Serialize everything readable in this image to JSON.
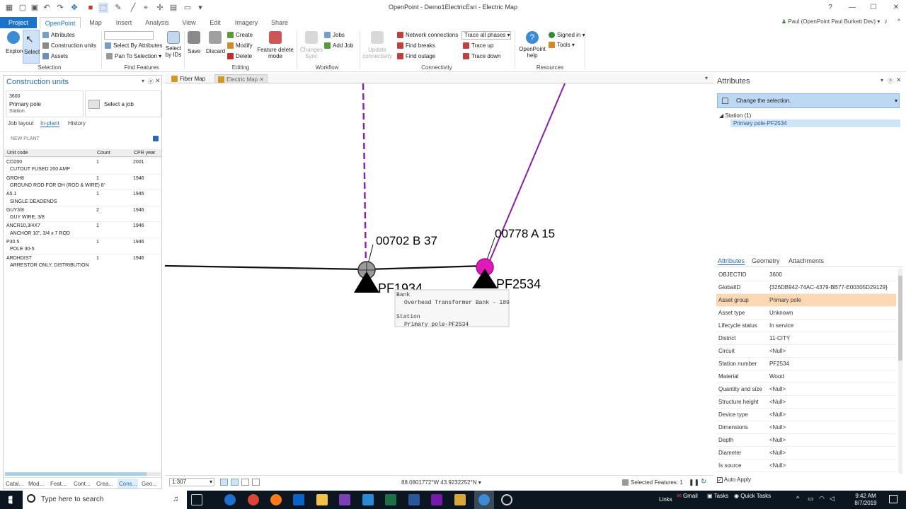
{
  "window": {
    "title": "OpenPoint - Demo1ElectricEsri - Electric Map",
    "help": "?",
    "minimize": "—",
    "maximize": "☐",
    "close": "✕"
  },
  "ribbon_tabs": [
    "Project",
    "OpenPoint",
    "Map",
    "Insert",
    "Analysis",
    "View",
    "Edit",
    "Imagery",
    "Share"
  ],
  "user": {
    "name": "Paul (OpenPoint Paul Burkett Dev)",
    "dropdown": "▾"
  },
  "ribbon": {
    "selection": {
      "explore": "Explore",
      "select": "Select",
      "attributes": "Attributes",
      "construction_units": "Construction units",
      "assets": "Assets",
      "group": "Selection"
    },
    "find": {
      "select_by_attributes": "Select By Attributes",
      "pan_to_selection": "Pan To Selection",
      "select_by_ids": "Select by IDs",
      "group": "Find Features"
    },
    "editing": {
      "save": "Save",
      "discard": "Discard",
      "create": "Create",
      "modify": "Modify",
      "delete": "Delete",
      "feature_delete": "Feature delete mode",
      "group": "Editing"
    },
    "workflow": {
      "changes_sync": "Changes Sync",
      "jobs": "Jobs",
      "add_job": "Add Job",
      "group": "Workflow"
    },
    "connectivity": {
      "update": "Update connectivity",
      "network": "Network connections",
      "trace_combo": "Trace all phases",
      "trace_up": "Trace up",
      "find_breaks": "Find breaks",
      "trace_down": "Trace down",
      "find_outage": "Find outage",
      "group": "Connectivity"
    },
    "resources": {
      "help": "OpenPoint help",
      "signed_in": "Signed in",
      "tools": "Tools",
      "group": "Resources"
    }
  },
  "left": {
    "title": "Construction units",
    "card": {
      "id": "3600",
      "name": "Primary pole",
      "type": "Station",
      "job": "Select a job"
    },
    "tabs": [
      "Job layout",
      "In-plant",
      "History"
    ],
    "new_plant": "NEW PLANT",
    "columns": [
      "Unit code",
      "Count",
      "CPR year"
    ],
    "rows": [
      {
        "code": "CO200",
        "count": "1",
        "year": "2001",
        "desc": "CUTOUT FUSED 200 AMP"
      },
      {
        "code": "GROH8",
        "count": "1",
        "year": "1946",
        "desc": "GROUND ROD FOR OH (ROD & WIRE) 8'"
      },
      {
        "code": "A5.1",
        "count": "1",
        "year": "1946",
        "desc": "SINGLE DEADENDS"
      },
      {
        "code": "GUY3/8",
        "count": "2",
        "year": "1946",
        "desc": "GUY WIRE, 3/8"
      },
      {
        "code": "ANCR10,3/4X7",
        "count": "1",
        "year": "1946",
        "desc": "ANCHOR 10\", 3/4 x 7 ROD"
      },
      {
        "code": "P30.5",
        "count": "1",
        "year": "1946",
        "desc": "POLE 30-5"
      },
      {
        "code": "ARDHDIST",
        "count": "1",
        "year": "1946",
        "desc": "ARRESTOR ONLY, DISTRIBUTION"
      }
    ],
    "bottom_tabs": [
      "Catal...",
      "Mod...",
      "Feat...",
      "Cont...",
      "Crea...",
      "Cons...",
      "Geo..."
    ]
  },
  "map": {
    "tabs": [
      "Fiber Map",
      "Electric Map"
    ],
    "labels": {
      "l1": "00702 B 37",
      "l2": "00778 A 15",
      "p1": "PF1934",
      "p2": "PF2534"
    },
    "popup": {
      "h1": "Bank",
      "v1": "Overhead Transformer Bank - 189",
      "h2": "Station",
      "v2": "Primary pole-PF2534"
    },
    "scale": "1:307",
    "coords": "88.0801772°W 43.9232252°N",
    "selected": "Selected Features: 1"
  },
  "right": {
    "title": "Attributes",
    "change_sel": "Change the selection.",
    "tree_root": "Station (1)",
    "tree_child": "Primary pole-PF2534",
    "tabs": [
      "Attributes",
      "Geometry",
      "Attachments"
    ],
    "rows": [
      {
        "k": "OBJECTID",
        "v": "3600"
      },
      {
        "k": "GlobalID",
        "v": "{326DB942-74AC-4379-BB77-E00305D29129}"
      },
      {
        "k": "Asset group",
        "v": "Primary pole"
      },
      {
        "k": "Asset type",
        "v": "Unknown"
      },
      {
        "k": "Lifecycle status",
        "v": "In service"
      },
      {
        "k": "District",
        "v": "11-CITY"
      },
      {
        "k": "Circuit",
        "v": "<Null>"
      },
      {
        "k": "Station number",
        "v": "PF2534"
      },
      {
        "k": "Material",
        "v": "Wood"
      },
      {
        "k": "Quantity and size",
        "v": "<Null>"
      },
      {
        "k": "Structure height",
        "v": "<Null>"
      },
      {
        "k": "Device type",
        "v": "<Null>"
      },
      {
        "k": "Dimensions",
        "v": "<Null>"
      },
      {
        "k": "Depth",
        "v": "<Null>"
      },
      {
        "k": "Diameter",
        "v": "<Null>"
      },
      {
        "k": "Is source",
        "v": "<Null>"
      }
    ],
    "auto_apply": "Auto Apply"
  },
  "taskbar": {
    "search": "Type here to search",
    "links": "Links",
    "gmail": "Gmail",
    "tasks": "Tasks",
    "quick": "Quick Tasks",
    "time": "9:42 AM",
    "date": "8/7/2019"
  }
}
